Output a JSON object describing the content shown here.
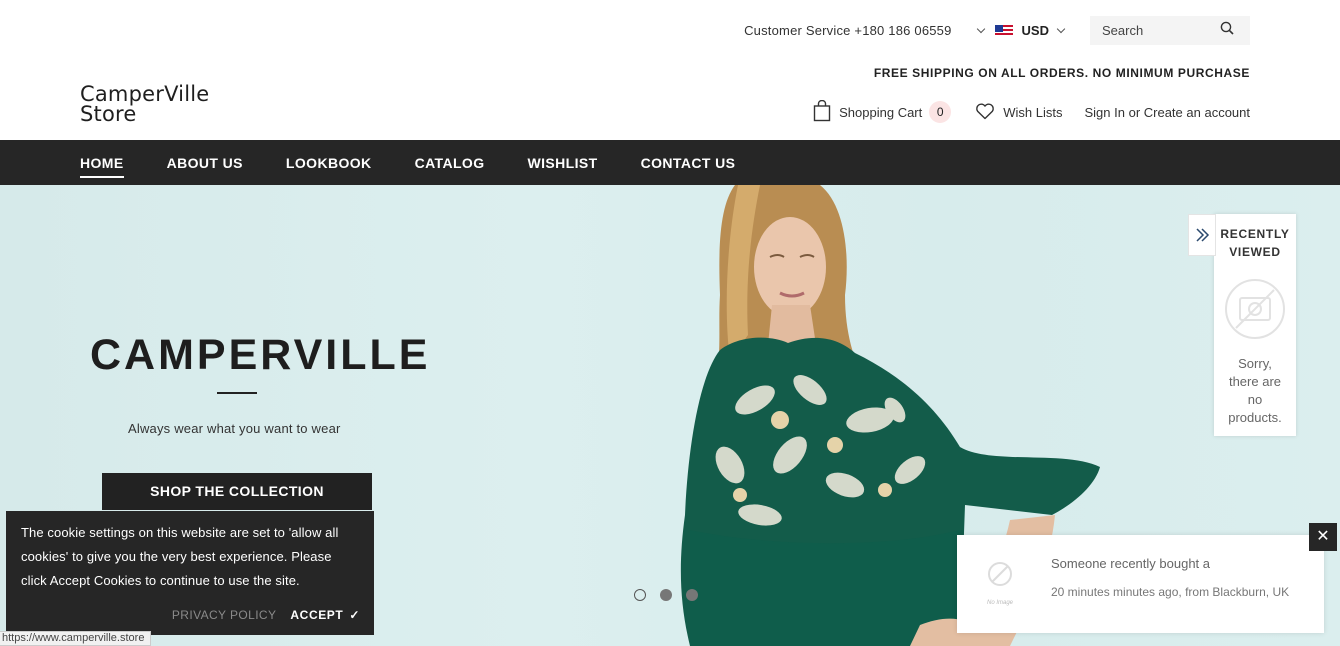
{
  "header": {
    "logo_line1": "CamperVille",
    "logo_line2": "Store",
    "customer_service": "Customer Service +180 186 06559",
    "currency": "USD",
    "search_placeholder": "Search",
    "free_shipping": "FREE SHIPPING ON ALL ORDERS. NO MINIMUM PURCHASE",
    "cart_label": "Shopping Cart",
    "cart_count": "0",
    "wishlist_label": "Wish Lists",
    "signin_label": "Sign In or Create an account"
  },
  "nav": {
    "items": [
      {
        "label": "HOME",
        "active": true
      },
      {
        "label": "ABOUT US"
      },
      {
        "label": "LOOKBOOK"
      },
      {
        "label": "CATALOG"
      },
      {
        "label": "WISHLIST"
      },
      {
        "label": "CONTACT US"
      }
    ]
  },
  "hero": {
    "title": "CAMPERVILLE",
    "subtitle": "Always wear what you want to wear",
    "button": "SHOP THE COLLECTION",
    "slide_count": 3,
    "active_slide": 1
  },
  "recently_viewed": {
    "title_line1": "RECENTLY",
    "title_line2": "VIEWED",
    "empty_line1": "Sorry,",
    "empty_line2": "there are",
    "empty_line3": "no",
    "empty_line4": "products."
  },
  "cookie": {
    "line1": "The cookie settings on this website are set to 'allow all",
    "line2": "cookies' to give you the very best experience. Please",
    "line3": "click Accept Cookies to continue to use the site.",
    "privacy": "PRIVACY POLICY",
    "accept": "ACCEPT",
    "accept_icon": "✓"
  },
  "notification": {
    "close_icon": "✕",
    "image_label": "No Image",
    "line1": "Someone recently bought a",
    "line2": "20 minutes minutes ago, from Blackburn, UK"
  },
  "status_url": "https://www.camperville.store",
  "colors": {
    "dark": "#262626",
    "hero_bg": "#d8eded",
    "dress_green": "#115e4c",
    "badge_bg": "#fbe4e4"
  }
}
